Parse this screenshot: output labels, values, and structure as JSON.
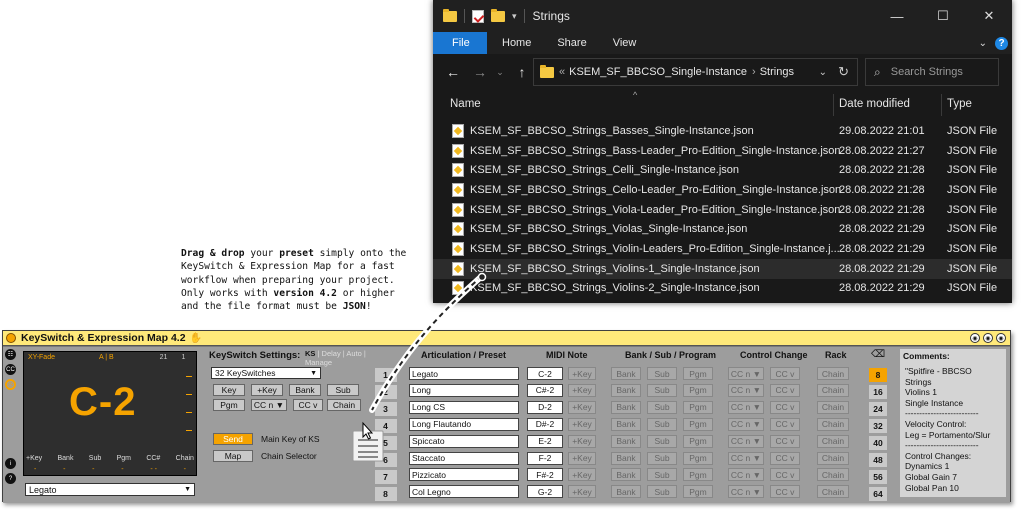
{
  "explorer": {
    "title": "Strings",
    "ribbon_tabs": [
      "File",
      "Home",
      "Share",
      "View"
    ],
    "address": {
      "parent": "KSEM_SF_BBCSO_Single-Instance",
      "current": "Strings",
      "prefix": "«"
    },
    "search_placeholder": "Search Strings",
    "columns": {
      "name": "Name",
      "date": "Date modified",
      "type": "Type"
    },
    "files": [
      {
        "name": "KSEM_SF_BBCSO_Strings_Basses_Single-Instance.json",
        "date": "29.08.2022 21:01",
        "type": "JSON File"
      },
      {
        "name": "KSEM_SF_BBCSO_Strings_Bass-Leader_Pro-Edition_Single-Instance.json",
        "date": "28.08.2022 21:27",
        "type": "JSON File"
      },
      {
        "name": "KSEM_SF_BBCSO_Strings_Celli_Single-Instance.json",
        "date": "28.08.2022 21:28",
        "type": "JSON File"
      },
      {
        "name": "KSEM_SF_BBCSO_Strings_Cello-Leader_Pro-Edition_Single-Instance.json",
        "date": "28.08.2022 21:28",
        "type": "JSON File"
      },
      {
        "name": "KSEM_SF_BBCSO_Strings_Viola-Leader_Pro-Edition_Single-Instance.json",
        "date": "28.08.2022 21:28",
        "type": "JSON File"
      },
      {
        "name": "KSEM_SF_BBCSO_Strings_Violas_Single-Instance.json",
        "date": "28.08.2022 21:29",
        "type": "JSON File"
      },
      {
        "name": "KSEM_SF_BBCSO_Strings_Violin-Leaders_Pro-Edition_Single-Instance.j...",
        "date": "28.08.2022 21:29",
        "type": "JSON File"
      },
      {
        "name": "KSEM_SF_BBCSO_Strings_Violins-1_Single-Instance.json",
        "date": "28.08.2022 21:29",
        "type": "JSON File"
      },
      {
        "name": "KSEM_SF_BBCSO_Strings_Violins-2_Single-Instance.json",
        "date": "28.08.2022 21:29",
        "type": "JSON File"
      }
    ],
    "highlighted_row": 7
  },
  "instructions": {
    "l1a": "Drag & drop",
    "l1b": " your ",
    "l1c": "preset",
    "l1d": " simply onto the",
    "l2": "KeySwitch & Expression Map for a fast",
    "l3": "workflow when preparing your project.",
    "l4a": "Only works with ",
    "l4b": "version 4.2",
    "l4c": " or higher",
    "l5a": "and the file format must be ",
    "l5b": "JSON",
    "l5c": "!"
  },
  "device": {
    "title": "KeySwitch & Expression Map 4.2",
    "display": {
      "xy_fade": "XY-Fade",
      "ab": "A | B",
      "n21": "21",
      "n1": "1",
      "big_key": "C-2",
      "labels": [
        "+Key",
        "Bank",
        "Sub",
        "Pgm",
        "CC#",
        "Chain"
      ],
      "dashes": [
        "-",
        "-",
        "-",
        "-",
        "- -",
        "-"
      ]
    },
    "articulation_select": "Legato",
    "settings": {
      "title": "KeySwitch Settings:",
      "tabs_active": "KS",
      "tabs_rest": " | Delay | Auto | Manage",
      "count_select": "32 KeySwitches",
      "buttons_row1": [
        "Key",
        "+Key",
        "Bank",
        "Sub"
      ],
      "buttons_row2": [
        "Pgm",
        "CC n ▼",
        "CC v",
        "Chain"
      ],
      "send": "Send",
      "send_label": "Main Key of KS",
      "map": "Map",
      "map_label": "Chain Selector"
    },
    "table_headers": {
      "articulation": "Articulation / Preset",
      "midi": "MIDI Note",
      "bank": "Bank / Sub / Program",
      "cc": "Control Change",
      "rack": "Rack"
    },
    "rows": [
      {
        "num": "1",
        "name": "Legato",
        "key": "C-2"
      },
      {
        "num": "2",
        "name": "Long",
        "key": "C#-2"
      },
      {
        "num": "3",
        "name": "Long CS",
        "key": "D-2"
      },
      {
        "num": "4",
        "name": "Long Flautando",
        "key": "D#-2"
      },
      {
        "num": "5",
        "name": "Spiccato",
        "key": "E-2"
      },
      {
        "num": "6",
        "name": "Staccato",
        "key": "F-2"
      },
      {
        "num": "7",
        "name": "Pizzicato",
        "key": "F#-2"
      },
      {
        "num": "8",
        "name": "Col Legno",
        "key": "G-2"
      }
    ],
    "row_buttons": {
      "pkey": "+Key",
      "bank": "Bank",
      "sub": "Sub",
      "pgm": "Pgm",
      "ccn": "CC n ▼",
      "ccv": "CC v",
      "chain": "Chain"
    },
    "pages": [
      "8",
      "16",
      "24",
      "32",
      "40",
      "48",
      "56",
      "64"
    ],
    "active_page": 0,
    "comments_title": "Comments:",
    "comments_body": "\"Spitfire - BBCSO\nStrings\nViolins 1\nSingle Instance\n--------------------------\nVelocity Control:\nLeg = Portamento/Slur\n--------------------------\nControl Changes:\nDynamics 1\nGlobal Gain 7\nGlobal Pan 10"
  },
  "colors": {
    "accent": "#f5a300",
    "explorer_blue": "#1976d2",
    "device_header": "#ffe97a"
  }
}
